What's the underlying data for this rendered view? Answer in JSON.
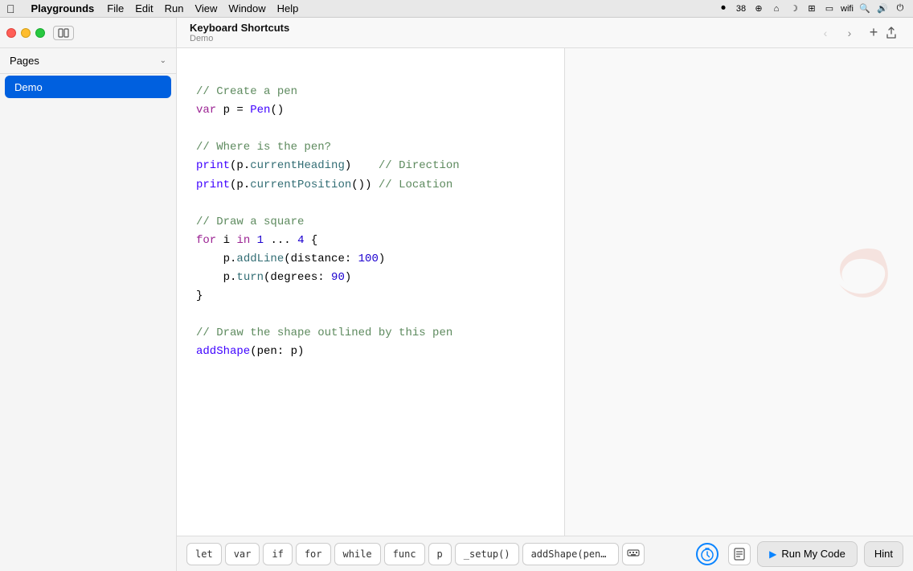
{
  "menubar": {
    "apple": "⌘",
    "app_name": "Playgrounds",
    "menus": [
      "File",
      "Edit",
      "Run",
      "View",
      "Window",
      "Help"
    ],
    "status_icons": [
      "■",
      "38",
      "⊕",
      "⌂",
      "☽",
      "⌲",
      "⬜",
      "🔋",
      "wifi",
      "🔍",
      "🔈",
      "⏻"
    ]
  },
  "sidebar": {
    "pages_label": "Pages",
    "pages": [
      {
        "id": "demo",
        "label": "Demo",
        "active": true
      }
    ]
  },
  "editor": {
    "title": "Keyboard Shortcuts",
    "subtitle": "Demo",
    "code_lines": [
      {
        "id": "l1",
        "type": "empty"
      },
      {
        "id": "l2",
        "content": "// Create a pen",
        "kind": "comment"
      },
      {
        "id": "l3",
        "content": "var p = Pen()",
        "kind": "mixed"
      },
      {
        "id": "l4",
        "type": "empty"
      },
      {
        "id": "l5",
        "content": "// Where is the pen?",
        "kind": "comment"
      },
      {
        "id": "l6",
        "content": "print(p.currentHeading)    // Direction",
        "kind": "mixed"
      },
      {
        "id": "l7",
        "content": "print(p.currentPosition()) // Location",
        "kind": "mixed"
      },
      {
        "id": "l8",
        "type": "empty"
      },
      {
        "id": "l9",
        "content": "// Draw a square",
        "kind": "comment"
      },
      {
        "id": "l10",
        "content": "for i in 1 ... 4 {",
        "kind": "mixed"
      },
      {
        "id": "l11",
        "content": "    p.addLine(distance: 100)",
        "kind": "mixed"
      },
      {
        "id": "l12",
        "content": "    p.turn(degrees: 90)",
        "kind": "mixed"
      },
      {
        "id": "l13",
        "content": "}",
        "kind": "plain"
      },
      {
        "id": "l14",
        "type": "empty"
      },
      {
        "id": "l15",
        "content": "// Draw the shape outlined by this pen",
        "kind": "comment"
      },
      {
        "id": "l16",
        "content": "addShape(pen: p)",
        "kind": "mixed"
      }
    ]
  },
  "bottom_toolbar": {
    "keywords": [
      "let",
      "var",
      "if",
      "for",
      "while",
      "func",
      "p"
    ],
    "snippets": [
      "_setup()",
      "addShape(pen: |"
    ],
    "run_label": "Run My Code",
    "hint_label": "Hint"
  }
}
